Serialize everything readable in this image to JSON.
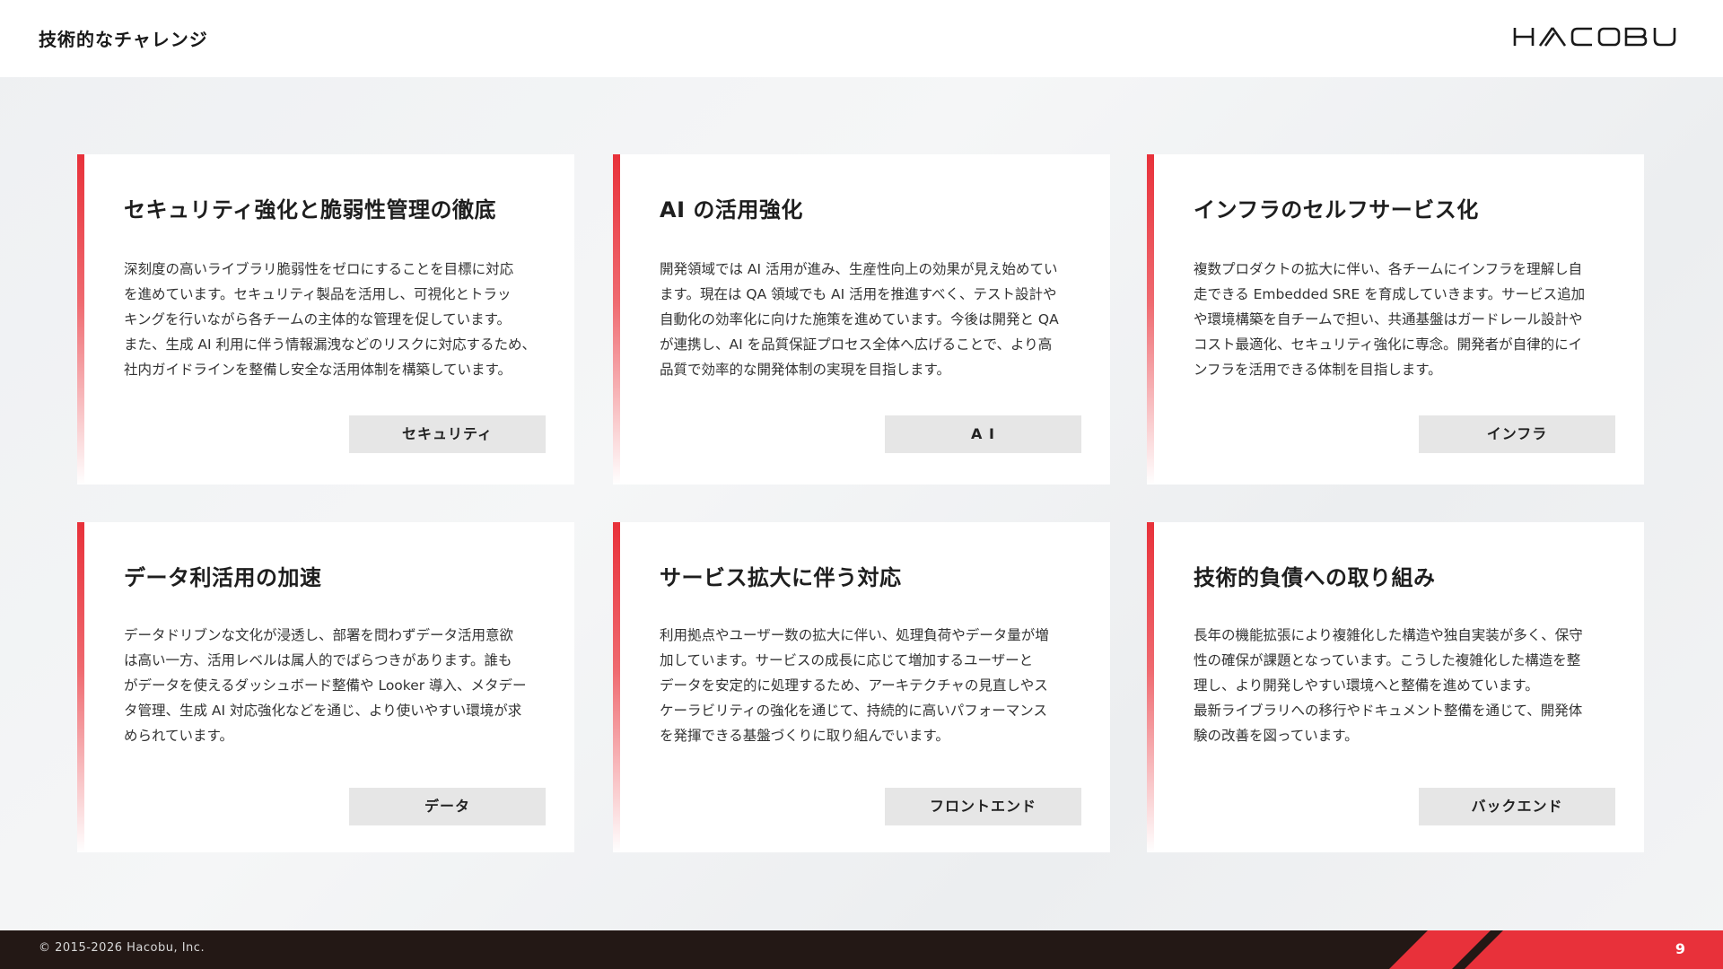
{
  "header": {
    "title": "技術的なチャレンジ",
    "logo_text": "HACOBU"
  },
  "cards": [
    {
      "title": "セキュリティ強化と脆弱性管理の徹底",
      "body": [
        "深刻度の高いライブラリ脆弱性をゼロにすることを目標に対応",
        "を進めています。セキュリティ製品を活用し、可視化とトラッ",
        "キングを行いながら各チームの主体的な管理を促しています。",
        "また、生成 AI 利用に伴う情報漏洩などのリスクに対応するため、",
        "社内ガイドラインを整備し安全な活用体制を構築しています。"
      ],
      "tag": "セキュリティ"
    },
    {
      "title": "AI の活用強化",
      "body": [
        "開発領域では AI 活用が進み、生産性向上の効果が見え始めてい",
        "ます。現在は QA 領域でも AI 活用を推進すべく、テスト設計や",
        "自動化の効率化に向けた施策を進めています。今後は開発と QA",
        "が連携し、AI を品質保証プロセス全体へ広げることで、より高",
        "品質で効率的な開発体制の実現を目指します。"
      ],
      "tag": "A I"
    },
    {
      "title": "インフラのセルフサービス化",
      "body": [
        "複数プロダクトの拡大に伴い、各チームにインフラを理解し自",
        "走できる Embedded SRE を育成していきます。サービス追加",
        "や環境構築を自チームで担い、共通基盤はガードレール設計や",
        "コスト最適化、セキュリティ強化に専念。開発者が自律的にイ",
        "ンフラを活用できる体制を目指します。"
      ],
      "tag": "インフラ"
    },
    {
      "title": "データ利活用の加速",
      "body": [
        "データドリブンな文化が浸透し、部署を問わずデータ活用意欲",
        "は高い一方、活用レベルは属人的でばらつきがあります。誰も",
        "がデータを使えるダッシュボード整備や Looker 導入、メタデー",
        "タ管理、生成 AI 対応強化などを通じ、より使いやすい環境が求",
        "められています。"
      ],
      "tag": "データ"
    },
    {
      "title": "サービス拡大に伴う対応",
      "body": [
        "利用拠点やユーザー数の拡大に伴い、処理負荷やデータ量が増",
        "加しています。サービスの成長に応じて増加するユーザーと",
        "データを安定的に処理するため、アーキテクチャの見直しやス",
        "ケーラビリティの強化を通じて、持続的に高いパフォーマンス",
        "を発揮できる基盤づくりに取り組んでいます。"
      ],
      "tag": "フロントエンド"
    },
    {
      "title": "技術的負債への取り組み",
      "body": [
        "長年の機能拡張により複雑化した構造や独自実装が多く、保守",
        "性の確保が課題となっています。こうした複雑化した構造を整",
        "理し、より開発しやすい環境へと整備を進めています。",
        "最新ライブラリへの移行やドキュメント整備を通じて、開発体",
        "験の改善を図っています。"
      ],
      "tag": "バックエンド"
    }
  ],
  "footer": {
    "copyright": "© 2015-2026 Hacobu, Inc.",
    "page_number": "9"
  },
  "colors": {
    "accent": "#e8313a",
    "footer_bg": "#231815",
    "tag_bg": "#e6e6e6"
  }
}
